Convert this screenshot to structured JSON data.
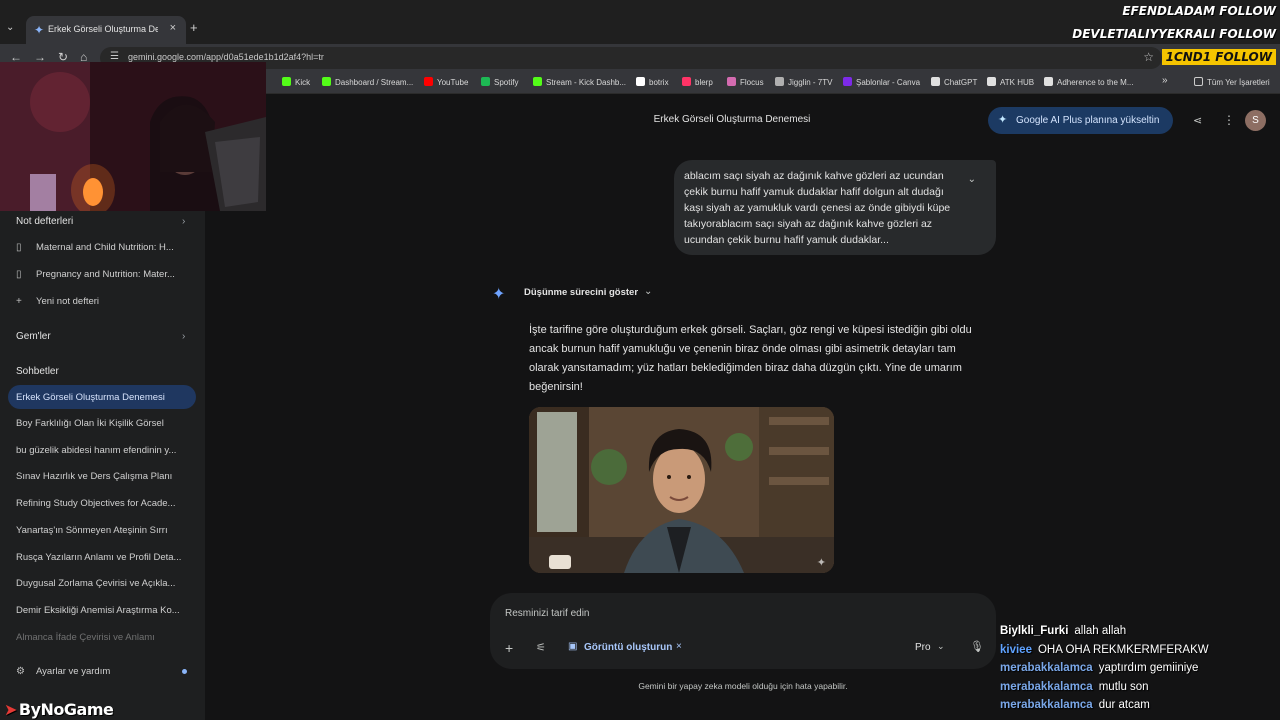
{
  "browser": {
    "tab_title": "Erkek Görseli Oluşturma Denem",
    "tab_close": "×",
    "new_tab": "+",
    "tab_menu": "⌄",
    "url": "gemini.google.com/app/d0a51ede1b1d2af4?hl=tr",
    "bookmarks": [
      {
        "label": "Kick",
        "color": "#53fc18"
      },
      {
        "label": "Dashboard / Stream...",
        "color": "#53fc18"
      },
      {
        "label": "YouTube",
        "color": "#ff0000"
      },
      {
        "label": "Spotify",
        "color": "#1db954"
      },
      {
        "label": "Stream - Kick Dashb...",
        "color": "#53fc18"
      },
      {
        "label": "botrix",
        "color": "#ffffff"
      },
      {
        "label": "blerp",
        "color": "#ff3366"
      },
      {
        "label": "Flocus",
        "color": "#d46bb0"
      },
      {
        "label": "Jigglin - 7TV",
        "color": "#b0b0b0"
      },
      {
        "label": "Şablonlar - Canva",
        "color": "#7d2ae8"
      },
      {
        "label": "ChatGPT",
        "color": "#e0e0e0"
      },
      {
        "label": "ATK HUB",
        "color": "#e0e0e0"
      },
      {
        "label": "Adherence to the M...",
        "color": "#e0e0e0"
      }
    ],
    "bookmarks_overflow": "»",
    "all_bookmarks": "Tüm Yer İşaretleri"
  },
  "sidebar": {
    "notebooks_heading": "Not defterleri",
    "notebooks": [
      "Maternal and Child Nutrition: H...",
      "Pregnancy and Nutrition: Mater..."
    ],
    "new_notebook": "Yeni not defteri",
    "gems_heading": "Gem'ler",
    "chats_heading": "Sohbetler",
    "active_chat": "Erkek Görseli Oluşturma Denemesi",
    "chats": [
      "Boy Farklılığı Olan İki Kişilik Görsel",
      "bu güzelik abidesi hanım efendinin y...",
      "Sınav Hazırlık ve Ders Çalışma Planı",
      "Refining Study Objectives for Acade...",
      "Yanartaş'ın Sönmeyen Ateşinin Sırrı",
      "Rusça Yazıların Anlamı ve Profil Deta...",
      "Duygusal Zorlama Çevirisi ve Açıkla...",
      "Demir Eksikliği Anemisi Araştırma Ko...",
      "Almanca İfade Çevirisi ve Anlamı"
    ],
    "settings": "Ayarlar ve yardım"
  },
  "main": {
    "title": "Erkek Görseli Oluşturma Denemesi",
    "upgrade_label": "Google AI Plus planına yükseltin",
    "avatar_letter": "S",
    "user_prompt": "ablacım saçı siyah az dağınık kahve gözleri az ucundan çekik burnu hafif yamuk dudaklar hafif dolgun alt dudağı kaşı siyah az yamukluk vardı çenesi az önde gibiydi küpe takıyorablacım saçı siyah az dağınık kahve gözleri az ucundan çekik burnu hafif yamuk dudaklar...",
    "show_thinking": "Düşünme sürecini göster",
    "response": "İşte tarifine göre oluşturduğum erkek görseli. Saçları, göz rengi ve küpesi istediğin gibi oldu ancak burnun hafif yamukluğu ve çenenin biraz önde olması gibi asimetrik detayları tam olarak yansıtamadım; yüz hatları beklediğimden biraz daha düzgün çıktı. Yine de umarım beğenirsin!",
    "composer_placeholder": "Resminizi tarif edin",
    "image_chip": "Görüntü oluşturun",
    "model": "Pro",
    "disclaimer": "Gemini bir yapay zeka modeli olduğu için hata yapabilir."
  },
  "overlay": {
    "follows": [
      "EFENDLADAM FOLLOW",
      "DEVLETIALIYYEKRALI FOLLOW",
      "1CND1 FOLLOW"
    ],
    "chat": [
      {
        "user": "Biylkli_Furki",
        "msg": "allah allah",
        "color": "#ffffff"
      },
      {
        "user": "kiviee",
        "msg": "OHA OHA REKMKERMFERAKW",
        "color": "#5fa2ff"
      },
      {
        "user": "merabakkalamca",
        "msg": "yaptırdım gemiiniye",
        "color": "#7aa7e8"
      },
      {
        "user": "merabakkalamca",
        "msg": "mutlu son",
        "color": "#7aa7e8"
      },
      {
        "user": "merabakkalamca",
        "msg": "dur atcam",
        "color": "#7aa7e8"
      }
    ],
    "watermark": "ByNoGame"
  }
}
